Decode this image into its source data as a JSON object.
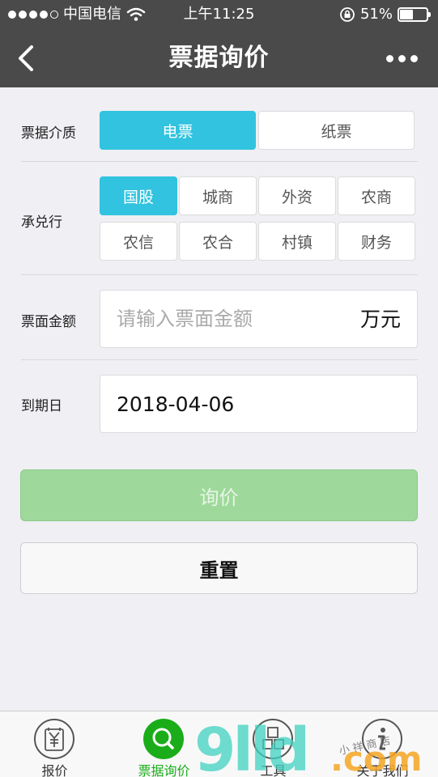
{
  "status_bar": {
    "carrier": "中国电信",
    "time": "上午11:25",
    "battery": "51%",
    "battery_level": 0.51
  },
  "nav": {
    "title": "票据询价"
  },
  "form": {
    "medium": {
      "label": "票据介质",
      "options": [
        "电票",
        "纸票"
      ],
      "selected": "电票"
    },
    "acceptor": {
      "label": "承兑行",
      "options": [
        "国股",
        "城商",
        "外资",
        "农商",
        "农信",
        "农合",
        "村镇",
        "财务"
      ],
      "selected": "国股"
    },
    "amount": {
      "label": "票面金额",
      "placeholder": "请输入票面金额",
      "value": "",
      "unit": "万元"
    },
    "due_date": {
      "label": "到期日",
      "value": "2018-04-06"
    }
  },
  "buttons": {
    "inquire": "询价",
    "reset": "重置"
  },
  "tabbar": {
    "items": [
      {
        "label": "报价",
        "icon": "yuan-tag-icon"
      },
      {
        "label": "票据询价",
        "icon": "search-icon"
      },
      {
        "label": "工具",
        "icon": "grid-tools-icon"
      },
      {
        "label": "关于我们",
        "icon": "info-icon"
      }
    ],
    "active_index": 1
  },
  "watermark": {
    "text": "9lld.com",
    "subtext": "小祥商店"
  },
  "colors": {
    "header_bg": "#4a4a4a",
    "accent": "#31c3df",
    "inquire_disabled": "#9ed99b",
    "tab_active": "#1aad19",
    "page_bg": "#efeff4"
  }
}
